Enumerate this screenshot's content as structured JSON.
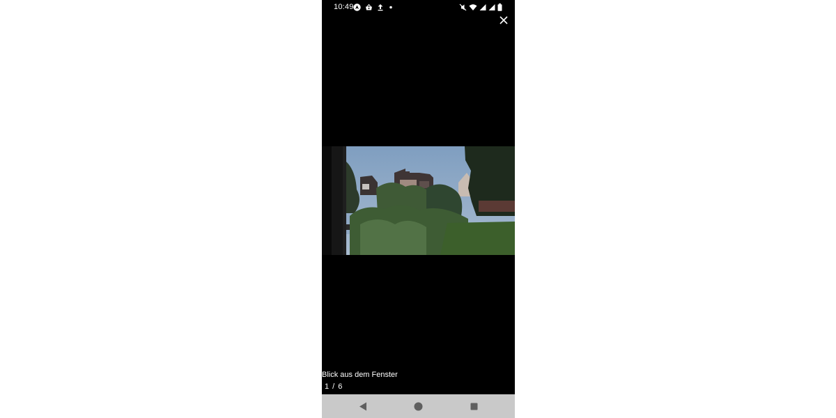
{
  "status_bar": {
    "time": "10:49",
    "left_icons": [
      "navigation-app-icon",
      "basket-app-icon",
      "upload-icon",
      "notification-dot-icon"
    ],
    "right_icons": [
      "mute-icon",
      "wifi-icon",
      "signal-icon",
      "signal-icon",
      "battery-icon"
    ]
  },
  "viewer": {
    "close_icon": "close-icon",
    "caption": "Blick aus dem Fenster",
    "counter": {
      "current": "1",
      "separator": "/",
      "total": "6"
    }
  },
  "photo": {
    "description_icon": "photo-image"
  },
  "nav_bar": {
    "buttons": [
      "back-icon",
      "home-icon",
      "recents-icon"
    ]
  },
  "colors": {
    "background": "#000000",
    "nav_bar": "#c9c9c9",
    "nav_icons": "#5f5f5f",
    "text": "#ffffff"
  }
}
